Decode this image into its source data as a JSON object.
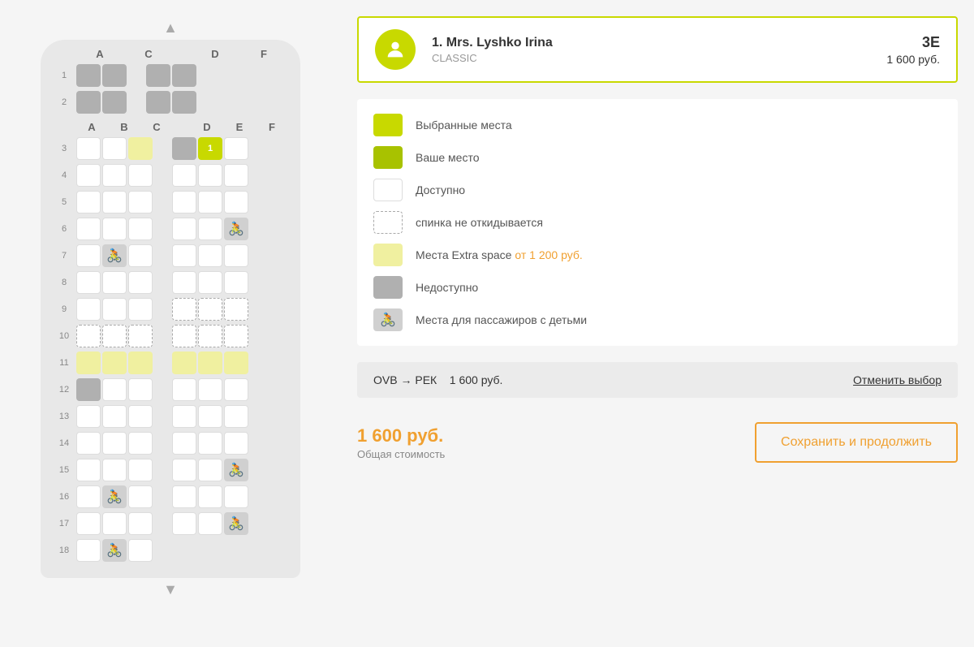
{
  "passenger": {
    "index": "1.",
    "name": "Mrs. Lyshko Irina",
    "class": "CLASSIC",
    "seat_code": "3E",
    "seat_price": "1 600 руб."
  },
  "legend": {
    "selected_label": "Выбранные места",
    "your_seat_label": "Ваше место",
    "available_label": "Доступно",
    "non_reclining_label": "спинка не откидывается",
    "extra_space_label": "Места Extra space",
    "extra_space_price": " от 1 200 руб.",
    "unavailable_label": "Недоступно",
    "baby_label": "Места для пассажиров с детьми"
  },
  "flight": {
    "from": "OVB",
    "arrow": "→",
    "to": "РЕК",
    "price": "1 600 руб.",
    "cancel_label": "Отменить выбор"
  },
  "total": {
    "price": "1 600 руб.",
    "label": "Общая стоимость",
    "save_label": "Сохранить и продолжить"
  },
  "nav": {
    "up": "▲",
    "down": "▼"
  },
  "columns": {
    "first_class": [
      "A",
      "",
      "C",
      "",
      "D",
      "",
      "F"
    ],
    "economy": [
      "A",
      "B",
      "C",
      "",
      "D",
      "E",
      "F"
    ]
  }
}
